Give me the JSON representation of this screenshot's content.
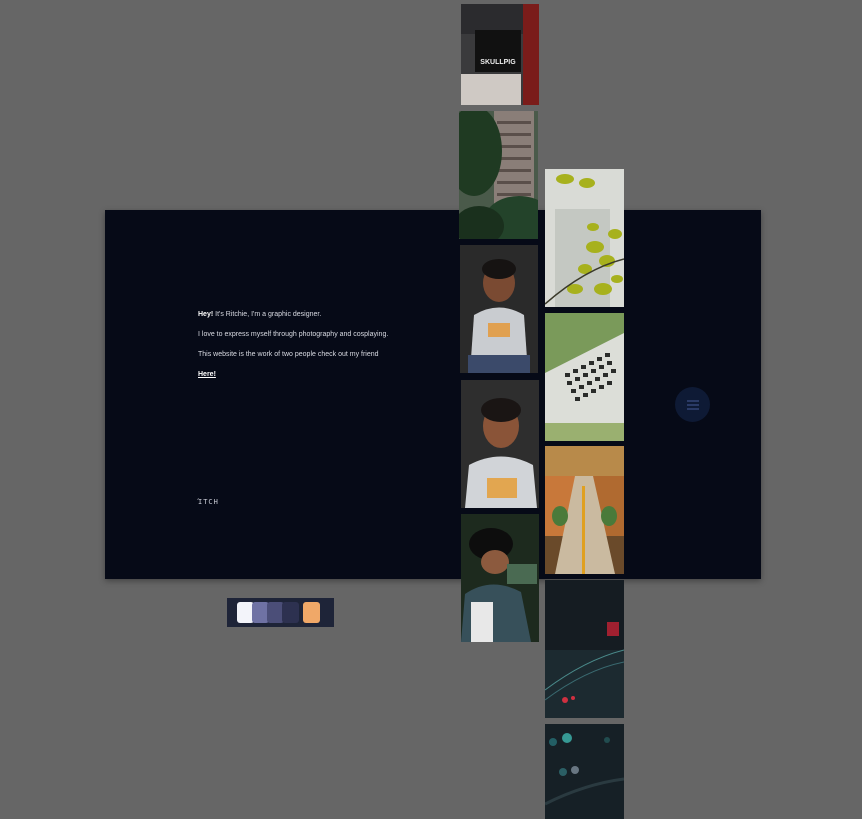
{
  "intro": {
    "line1_bold": "Hey!",
    "line1_rest": " It's Ritchie, I'm a graphic designer.",
    "line2": "I love to express myself through photography and cosplaying.",
    "line3": "This website is the work of two people check out my friend",
    "link_label": "Here!"
  },
  "logo_text": "ΊTCH",
  "menu": {
    "icon": "hamburger-menu-icon"
  },
  "photos": [
    {
      "name": "photo-skullpig-sign",
      "sign_text": "SKULLPIG"
    },
    {
      "name": "photo-tall-building"
    },
    {
      "name": "photo-boy-portrait-seated"
    },
    {
      "name": "photo-boy-portrait-closeup"
    },
    {
      "name": "photo-person-working"
    },
    {
      "name": "photo-leaves-building"
    },
    {
      "name": "photo-keyboard"
    },
    {
      "name": "photo-mall-interior"
    },
    {
      "name": "photo-night-city"
    },
    {
      "name": "photo-bokeh-lights"
    }
  ],
  "palette": {
    "colors": [
      "#f3f4fa",
      "#6f72a4",
      "#4b4e78",
      "#2d3150",
      "#f0a868"
    ]
  },
  "colors": {
    "background": "#666666",
    "panel": "#060a17",
    "menu_button": "#0e1a35"
  }
}
